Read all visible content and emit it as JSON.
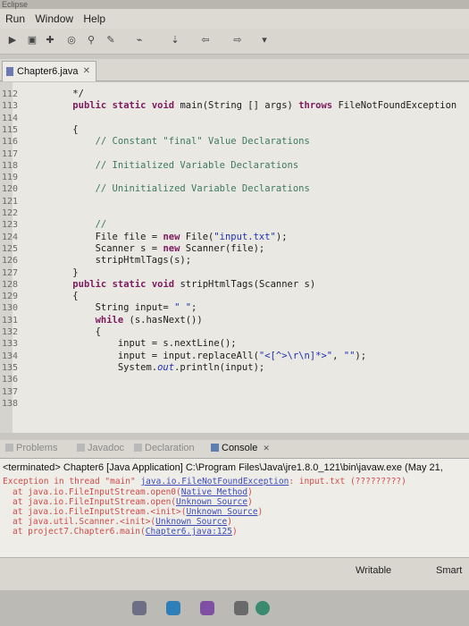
{
  "window": {
    "title_fragment": "Eclipse"
  },
  "menu": {
    "items": [
      "Run",
      "Window",
      "Help"
    ]
  },
  "editor": {
    "tab_label": "Chapter6.java",
    "lines": [
      {
        "n": "112",
        "code": "    */"
      },
      {
        "n": "113",
        "code": "    public static void main(String [] args) throws FileNotFoundException"
      },
      {
        "n": "114",
        "code": ""
      },
      {
        "n": "115",
        "code": "    {"
      },
      {
        "n": "116",
        "code": "        // Constant \"final\" Value Declarations"
      },
      {
        "n": "117",
        "code": ""
      },
      {
        "n": "118",
        "code": "        // Initialized Variable Declarations"
      },
      {
        "n": "119",
        "code": ""
      },
      {
        "n": "120",
        "code": "        // Uninitialized Variable Declarations"
      },
      {
        "n": "121",
        "code": ""
      },
      {
        "n": "122",
        "code": ""
      },
      {
        "n": "123",
        "code": "        //"
      },
      {
        "n": "124",
        "code": "        File file = new File(\"input.txt\");"
      },
      {
        "n": "125",
        "code": "        Scanner s = new Scanner(file);"
      },
      {
        "n": "126",
        "code": "        stripHtmlTags(s);"
      },
      {
        "n": "127",
        "code": "    }"
      },
      {
        "n": "128",
        "code": "    public static void stripHtmlTags(Scanner s)"
      },
      {
        "n": "129",
        "code": "    {"
      },
      {
        "n": "130",
        "code": "        String input= \" \";"
      },
      {
        "n": "131",
        "code": "        while (s.hasNext())"
      },
      {
        "n": "132",
        "code": "        {"
      },
      {
        "n": "133",
        "code": "            input = s.nextLine();"
      },
      {
        "n": "134",
        "code": "            input = input.replaceAll(\"<[^>\\r\\n]*>\", \"\");"
      },
      {
        "n": "135",
        "code": "            System.out.println(input);"
      },
      {
        "n": "136",
        "code": ""
      },
      {
        "n": "137",
        "code": ""
      },
      {
        "n": "138",
        "code": ""
      }
    ]
  },
  "views": {
    "tabs": [
      "Problems",
      "Javadoc",
      "Declaration",
      "Console"
    ],
    "active": "Console"
  },
  "console": {
    "terminated": "<terminated> Chapter6 [Java Application] C:\\Program Files\\Java\\jre1.8.0_121\\bin\\javaw.exe (May 21,",
    "exception": "Exception in thread \"main\" java.io.FileNotFoundException: input.txt (?????????)",
    "trace": [
      "at java.io.FileInputStream.open0(Native Method)",
      "at java.io.FileInputStream.open(Unknown Source)",
      "at java.io.FileInputStream.<init>(Unknown Source)",
      "at java.util.Scanner.<init>(Unknown Source)",
      "at project7.Chapter6.main(Chapter6.java:125)"
    ]
  },
  "status": {
    "writable": "Writable",
    "insert_mode": "Smart"
  },
  "colors": {
    "keyword": "#7d1a5e",
    "string": "#1e2fb3",
    "comment": "#3e7a5a",
    "error": "#d04a48"
  }
}
